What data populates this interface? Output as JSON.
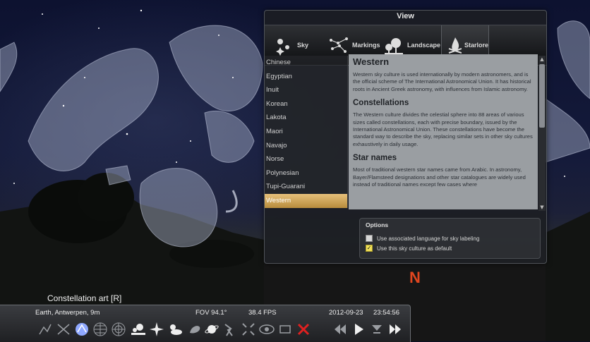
{
  "dialog": {
    "title": "View",
    "tabs": [
      "Sky",
      "Markings",
      "Landscape",
      "Starlore"
    ]
  },
  "cultures": [
    "Chinese",
    "Egyptian",
    "Inuit",
    "Korean",
    "Lakota",
    "Maori",
    "Navajo",
    "Norse",
    "Polynesian",
    "Tupi-Guarani",
    "Western"
  ],
  "selected_culture": "Western",
  "description": {
    "title": "Western",
    "p1": "Western sky culture is used internationally by modern astronomers, and is the official scheme of The International Astronomical Union. It has historical roots in Ancient Greek astronomy, with influences from Islamic astronomy.",
    "h_constellations": "Constellations",
    "p2": "The Western culture divides the celestial sphere into 88 areas of various sizes called constellations, each with precise boundary, issued by the International Astronomical Union. These constellations have become the standard way to describe the sky, replacing similar sets in other sky cultures exhaustively in daily usage.",
    "h_star_names": "Star names",
    "p3": "Most of traditional western star names came from Arabic. In astronomy, Bayer/Flamsteed designations and other star catalogues are widely used instead of traditional names except few cases where"
  },
  "options": {
    "title": "Options",
    "opt1_label": "Use associated language for sky labeling",
    "opt1_checked": false,
    "opt2_label": "Use this sky culture as default",
    "opt2_checked": true
  },
  "status": {
    "button_info": "Constellation art  [R]",
    "location": "Earth, Antwerpen, 9m",
    "fov": "FOV 94.1°",
    "fps": "38.4 FPS",
    "date": "2012-09-23",
    "time": "23:54:56"
  },
  "compass": "N",
  "toolbar_icons": [
    "constellation-lines-icon",
    "constellation-labels-icon",
    "constellation-art-icon",
    "equatorial-grid-icon",
    "azimuthal-grid-icon",
    "ground-icon",
    "cardinal-points-icon",
    "atmosphere-icon",
    "nebulas-icon",
    "planets-icon",
    "equatorial-mount-icon",
    "center-object-icon",
    "night-mode-icon",
    "fullscreen-icon",
    "quit-icon",
    "rewind-icon",
    "play-icon",
    "real-time-icon",
    "fast-forward-icon"
  ],
  "colors": {
    "accent": "#d4a85a",
    "compass": "#e0461f",
    "quit": "#e02020"
  }
}
